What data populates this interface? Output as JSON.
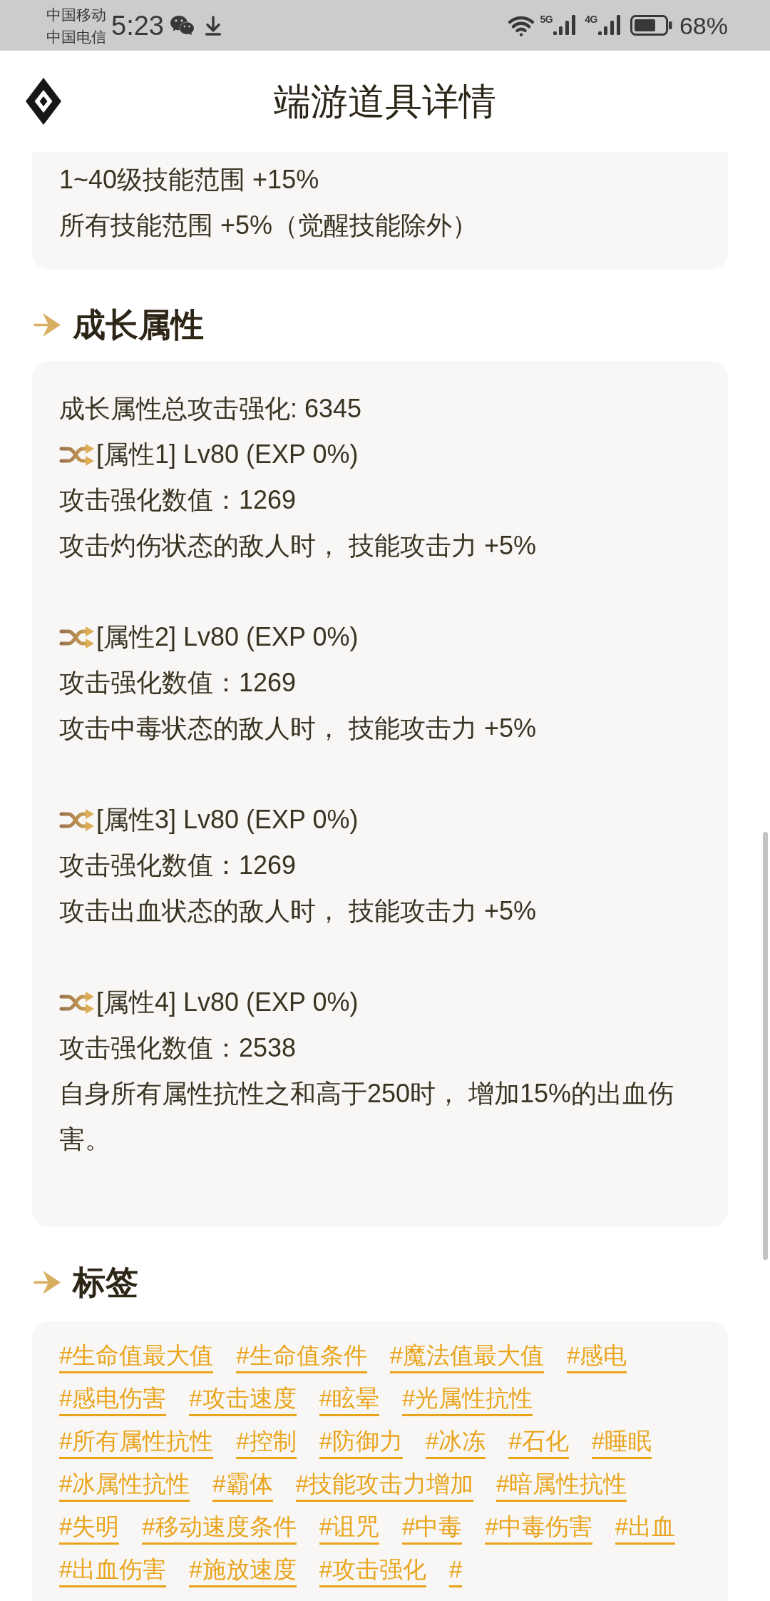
{
  "status_bar": {
    "carriers": [
      "中国移动",
      "中国电信"
    ],
    "time": "5:23",
    "network_types": [
      "5G",
      "4G"
    ],
    "battery": "68%"
  },
  "header": {
    "title": "端游道具详情"
  },
  "effects": {
    "lines": [
      "1~40级技能范围 +15%",
      "所有技能范围 +5%（觉醒技能除外）"
    ]
  },
  "growth": {
    "title": "成长属性",
    "total": "成长属性总攻击强化: 6345",
    "attributes": [
      {
        "name": "[属性1] Lv80 (EXP 0%)",
        "value": "攻击强化数值：1269",
        "effect": "攻击灼伤状态的敌人时， 技能攻击力 +5%"
      },
      {
        "name": "[属性2] Lv80 (EXP 0%)",
        "value": "攻击强化数值：1269",
        "effect": "攻击中毒状态的敌人时， 技能攻击力 +5%"
      },
      {
        "name": "[属性3] Lv80 (EXP 0%)",
        "value": "攻击强化数值：1269",
        "effect": "攻击出血状态的敌人时， 技能攻击力 +5%"
      },
      {
        "name": "[属性4] Lv80 (EXP 0%)",
        "value": "攻击强化数值：2538",
        "effect": "自身所有属性抗性之和高于250时， 增加15%的出血伤害。"
      }
    ]
  },
  "tags": {
    "title": "标签",
    "items": [
      "#生命值最大值",
      "#生命值条件",
      "#魔法值最大值",
      "#感电",
      "#感电伤害",
      "#攻击速度",
      "#眩晕",
      "#光属性抗性",
      "#所有属性抗性",
      "#控制",
      "#防御力",
      "#冰冻",
      "#石化",
      "#睡眠",
      "#冰属性抗性",
      "#霸体",
      "#技能攻击力增加",
      "#暗属性抗性",
      "#失明",
      "#移动速度条件",
      "#诅咒",
      "#中毒",
      "#中毒伤害",
      "#出血",
      "#出血伤害",
      "#施放速度",
      "#攻击强化",
      "#"
    ]
  }
}
